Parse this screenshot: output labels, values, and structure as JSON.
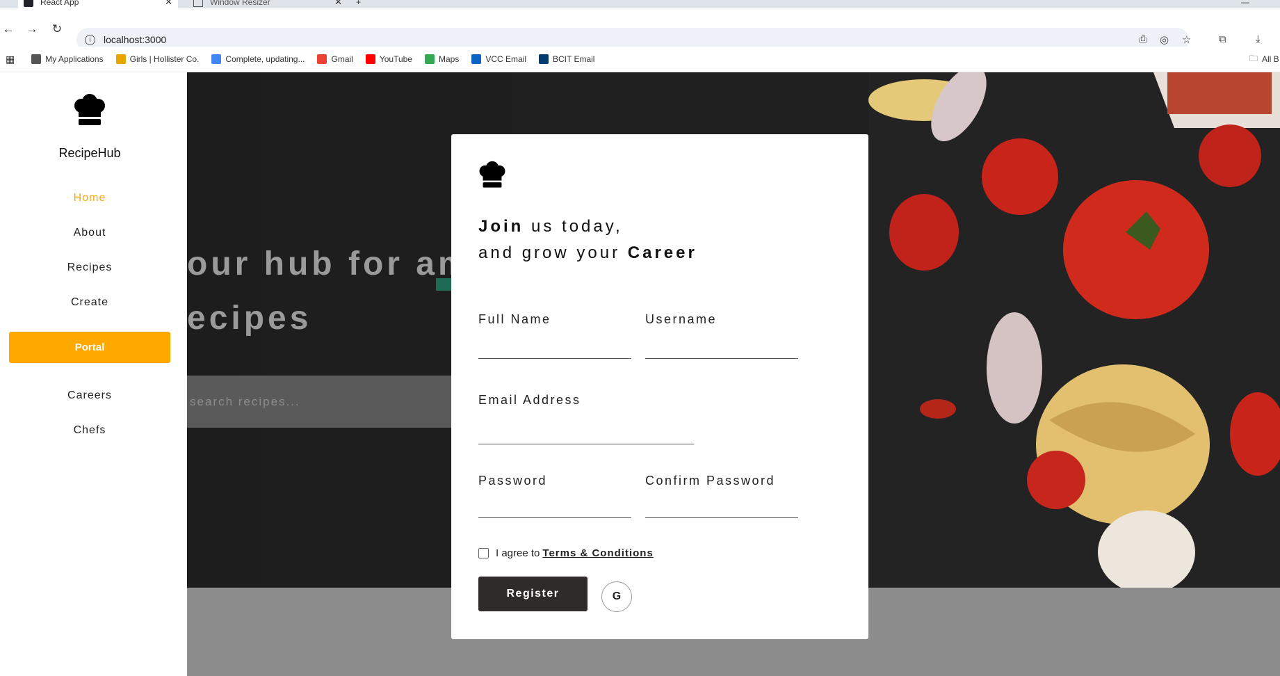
{
  "browser": {
    "tabs": [
      {
        "label": "React App",
        "active": true
      },
      {
        "label": "Window Resizer",
        "active": false
      }
    ],
    "new_tab_icon": "plus-icon",
    "url": "localhost:3000",
    "bookmarks": [
      {
        "label": "My Applications",
        "color": "#555555"
      },
      {
        "label": "Girls | Hollister Co.",
        "color": "#e8a400"
      },
      {
        "label": "Complete, updating...",
        "color": "#4285f4"
      },
      {
        "label": "Gmail",
        "color": "#ea4335"
      },
      {
        "label": "YouTube",
        "color": "#ff0000"
      },
      {
        "label": "Maps",
        "color": "#34a853"
      },
      {
        "label": "VCC Email",
        "color": "#0a66c2"
      },
      {
        "label": "BCIT Email",
        "color": "#003c71"
      }
    ],
    "all_bookmarks_label": "All B"
  },
  "sidebar": {
    "brand": "RecipeHub",
    "items": [
      {
        "label": "Home",
        "active": true
      },
      {
        "label": "About"
      },
      {
        "label": "Recipes"
      },
      {
        "label": "Create"
      }
    ],
    "portal_label": "Portal",
    "items_after": [
      {
        "label": "Careers"
      },
      {
        "label": "Chefs"
      }
    ],
    "accent_color": "#ffa800"
  },
  "hero": {
    "line1": "our hub for am",
    "line2": "ecipes",
    "search_placeholder": "search recipes..."
  },
  "modal": {
    "headline_line1_bold": "Join",
    "headline_line1_rest": " us today,",
    "headline_line2_rest": "and grow your ",
    "headline_line2_bold": "Career",
    "fields": {
      "full_name": "Full Name",
      "username": "Username",
      "email": "Email Address",
      "password": "Password",
      "confirm_password": "Confirm Password"
    },
    "agree_text": "I agree to",
    "terms_link": "Terms & Conditions",
    "register_label": "Register",
    "google_label": "G"
  }
}
